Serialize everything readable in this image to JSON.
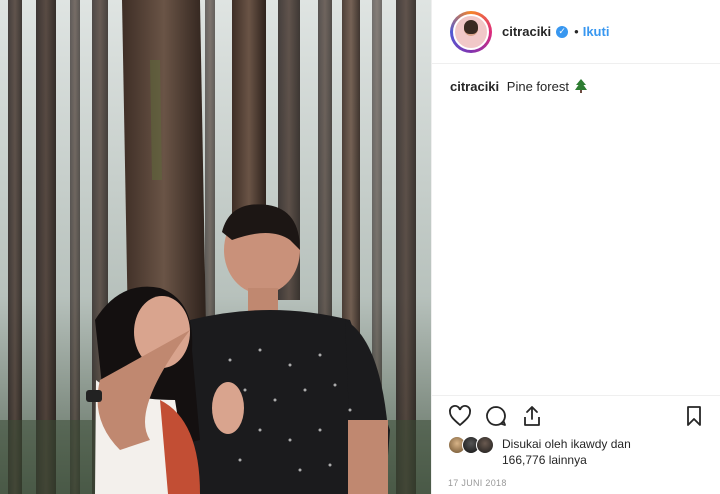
{
  "post": {
    "username": "citraciki",
    "verified_mark": "✓",
    "dot": "•",
    "follow_label": "Ikuti",
    "caption_user": "citraciki",
    "caption_text": "Pine forest",
    "caption_emoji_icon": "evergreen-tree-icon",
    "likes_text_line1": "Disukai oleh ikawdy dan",
    "likes_text_line2": "166,776 lainnya",
    "date": "17 JUNI 2018"
  },
  "icons": {
    "like": "heart-icon",
    "comment": "comment-icon",
    "share": "share-icon",
    "save": "bookmark-icon"
  },
  "colors": {
    "accent": "#3897f0",
    "text": "#262626",
    "muted": "#999999",
    "border": "#efefef"
  }
}
